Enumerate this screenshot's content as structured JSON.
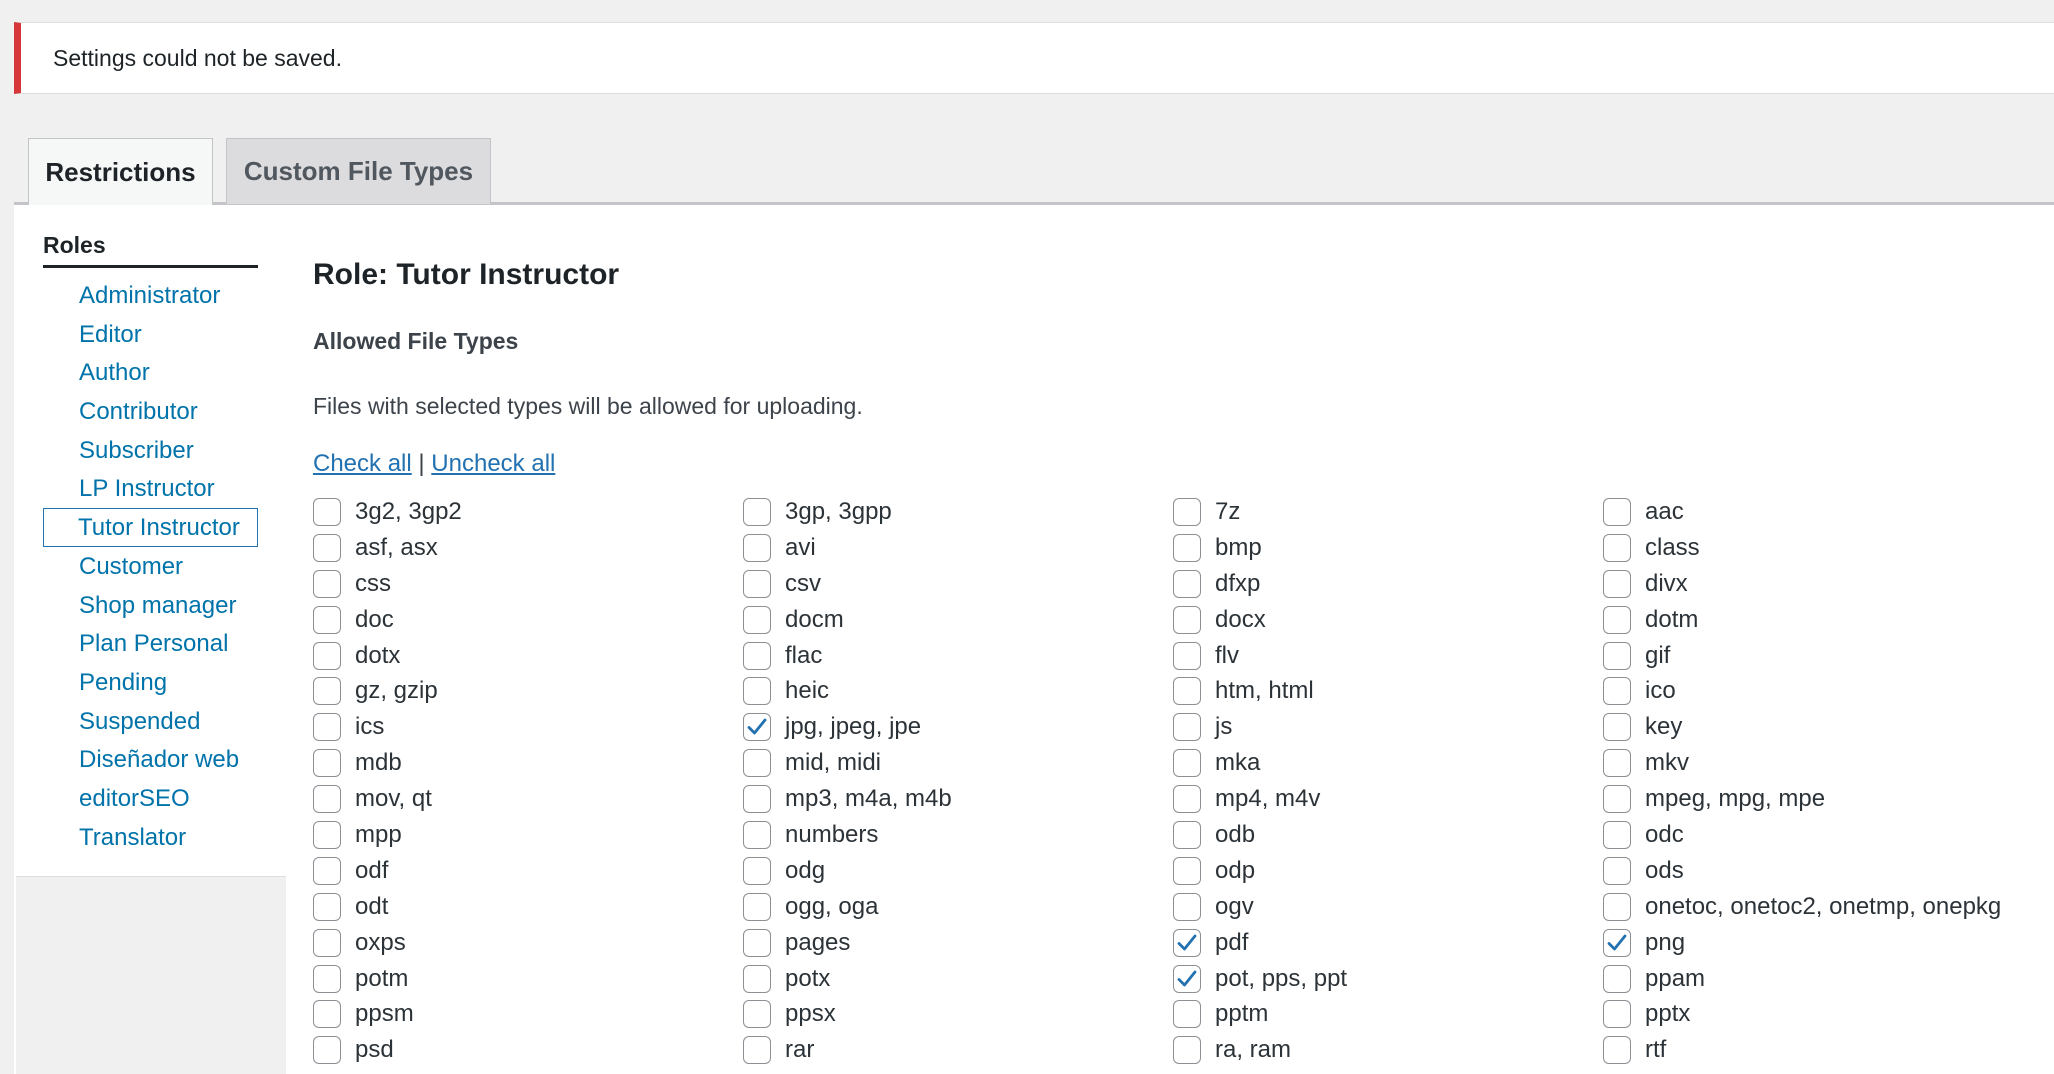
{
  "notice": {
    "text": "Settings could not be saved.",
    "color": "#d63638"
  },
  "tabs": [
    {
      "label": "Restrictions",
      "active": true
    },
    {
      "label": "Custom File Types",
      "active": false
    }
  ],
  "sidebar": {
    "title": "Roles",
    "items": [
      {
        "label": "Administrator"
      },
      {
        "label": "Editor"
      },
      {
        "label": "Author"
      },
      {
        "label": "Contributor"
      },
      {
        "label": "Subscriber"
      },
      {
        "label": "LP Instructor"
      },
      {
        "label": "Tutor Instructor",
        "selected": true
      },
      {
        "label": "Customer"
      },
      {
        "label": "Shop manager"
      },
      {
        "label": "Plan Personal"
      },
      {
        "label": "Pending"
      },
      {
        "label": "Suspended"
      },
      {
        "label": "Diseñador web"
      },
      {
        "label": "editorSEO"
      },
      {
        "label": "Translator"
      }
    ]
  },
  "main": {
    "role_heading": "Role: Tutor Instructor",
    "allowed_heading": "Allowed File Types",
    "description": "Files with selected types will be allowed for uploading.",
    "check_all": "Check all",
    "separator": "|",
    "uncheck_all": "Uncheck all",
    "accent_color": "#2271b1",
    "file_types": [
      {
        "label": "3g2, 3gp2",
        "checked": false
      },
      {
        "label": "3gp, 3gpp",
        "checked": false
      },
      {
        "label": "7z",
        "checked": false
      },
      {
        "label": "aac",
        "checked": false
      },
      {
        "label": "asf, asx",
        "checked": false
      },
      {
        "label": "avi",
        "checked": false
      },
      {
        "label": "bmp",
        "checked": false
      },
      {
        "label": "class",
        "checked": false
      },
      {
        "label": "css",
        "checked": false
      },
      {
        "label": "csv",
        "checked": false
      },
      {
        "label": "dfxp",
        "checked": false
      },
      {
        "label": "divx",
        "checked": false
      },
      {
        "label": "doc",
        "checked": false
      },
      {
        "label": "docm",
        "checked": false
      },
      {
        "label": "docx",
        "checked": false
      },
      {
        "label": "dotm",
        "checked": false
      },
      {
        "label": "dotx",
        "checked": false
      },
      {
        "label": "flac",
        "checked": false
      },
      {
        "label": "flv",
        "checked": false
      },
      {
        "label": "gif",
        "checked": false
      },
      {
        "label": "gz, gzip",
        "checked": false
      },
      {
        "label": "heic",
        "checked": false
      },
      {
        "label": "htm, html",
        "checked": false
      },
      {
        "label": "ico",
        "checked": false
      },
      {
        "label": "ics",
        "checked": false
      },
      {
        "label": "jpg, jpeg, jpe",
        "checked": true
      },
      {
        "label": "js",
        "checked": false
      },
      {
        "label": "key",
        "checked": false
      },
      {
        "label": "mdb",
        "checked": false
      },
      {
        "label": "mid, midi",
        "checked": false
      },
      {
        "label": "mka",
        "checked": false
      },
      {
        "label": "mkv",
        "checked": false
      },
      {
        "label": "mov, qt",
        "checked": false
      },
      {
        "label": "mp3, m4a, m4b",
        "checked": false
      },
      {
        "label": "mp4, m4v",
        "checked": false
      },
      {
        "label": "mpeg, mpg, mpe",
        "checked": false
      },
      {
        "label": "mpp",
        "checked": false
      },
      {
        "label": "numbers",
        "checked": false
      },
      {
        "label": "odb",
        "checked": false
      },
      {
        "label": "odc",
        "checked": false
      },
      {
        "label": "odf",
        "checked": false
      },
      {
        "label": "odg",
        "checked": false
      },
      {
        "label": "odp",
        "checked": false
      },
      {
        "label": "ods",
        "checked": false
      },
      {
        "label": "odt",
        "checked": false
      },
      {
        "label": "ogg, oga",
        "checked": false
      },
      {
        "label": "ogv",
        "checked": false
      },
      {
        "label": "onetoc, onetoc2, onetmp, onepkg",
        "checked": false
      },
      {
        "label": "oxps",
        "checked": false
      },
      {
        "label": "pages",
        "checked": false
      },
      {
        "label": "pdf",
        "checked": true
      },
      {
        "label": "png",
        "checked": true
      },
      {
        "label": "potm",
        "checked": false
      },
      {
        "label": "potx",
        "checked": false
      },
      {
        "label": "pot, pps, ppt",
        "checked": true
      },
      {
        "label": "ppam",
        "checked": false
      },
      {
        "label": "ppsm",
        "checked": false
      },
      {
        "label": "ppsx",
        "checked": false
      },
      {
        "label": "pptm",
        "checked": false
      },
      {
        "label": "pptx",
        "checked": false
      },
      {
        "label": "psd",
        "checked": false
      },
      {
        "label": "rar",
        "checked": false
      },
      {
        "label": "ra, ram",
        "checked": false
      },
      {
        "label": "rtf",
        "checked": false
      }
    ]
  }
}
